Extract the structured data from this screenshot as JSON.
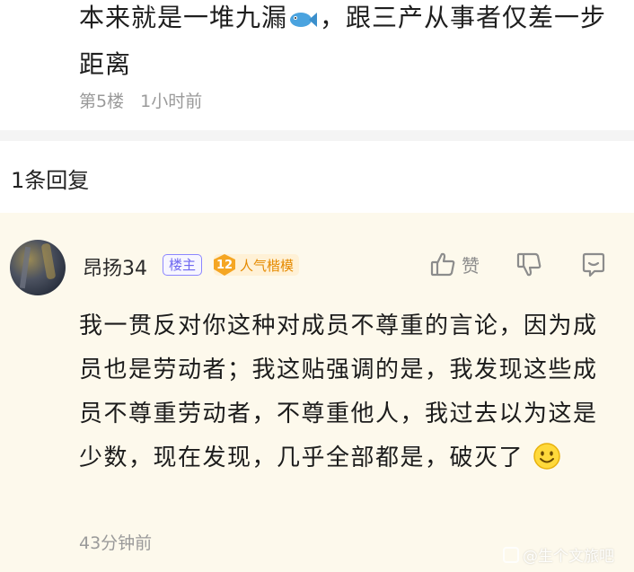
{
  "top_post": {
    "text_part1": "本来就是一堆九漏",
    "fish_icon": "fish-emoji",
    "text_part2": "，跟三产从事者仅差一步距离",
    "floor": "第5楼",
    "time": "1小时前"
  },
  "replies_header": {
    "count_label": "1条回复"
  },
  "reply": {
    "avatar_icon": "avatar",
    "username": "昂扬34",
    "owner_badge": "楼主",
    "level_number": "12",
    "level_label": "人气楷模",
    "like_label": "赞",
    "text": "我一贯反对你这种对成员不尊重的言论，因为成员也是劳动者；我这贴强调的是，我发现这些成员不尊重劳动者，不尊重他人，我过去以为这是少数，现在发现，几乎全部都是，破灭了",
    "smile_icon": "smile-emoji",
    "time": "43分钟前"
  },
  "watermark": {
    "text": "@生个文旅吧"
  },
  "colors": {
    "highlight_bg": "#fdf9ec",
    "owner_badge": "#6e67f0",
    "level_badge": "#f5a623",
    "meta_text": "#9a9a9a"
  }
}
